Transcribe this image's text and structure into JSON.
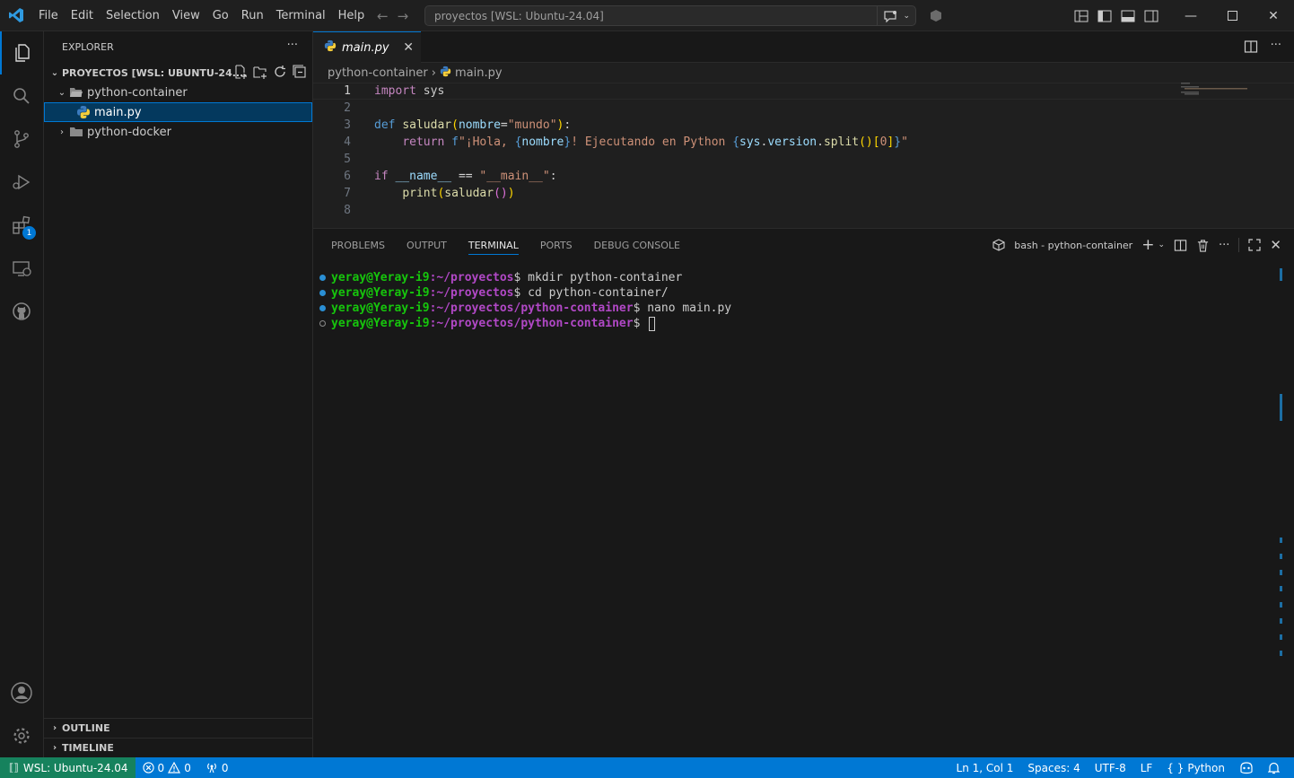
{
  "titlebar": {
    "menu": [
      "File",
      "Edit",
      "Selection",
      "View",
      "Go",
      "Run",
      "Terminal",
      "Help"
    ],
    "search_text": "proyectos [WSL: Ubuntu-24.04]"
  },
  "activitybar": {
    "extensions_badge": "1"
  },
  "sidebar": {
    "title": "EXPLORER",
    "more": "···",
    "folder": "PROYECTOS [WSL: UBUNTU-24....",
    "tree": [
      {
        "label": "python-container"
      },
      {
        "label": "main.py"
      },
      {
        "label": "python-docker"
      }
    ],
    "outline": "OUTLINE",
    "timeline": "TIMELINE"
  },
  "editor": {
    "tab_label": "main.py",
    "breadcrumb": [
      "python-container",
      "main.py"
    ],
    "line_numbers": [
      "1",
      "2",
      "3",
      "4",
      "5",
      "6",
      "7",
      "8"
    ]
  },
  "panel": {
    "tabs": [
      "PROBLEMS",
      "OUTPUT",
      "TERMINAL",
      "PORTS",
      "DEBUG CONSOLE"
    ],
    "terminal_name": "bash - python-container",
    "lines": [
      {
        "user": "yeray@Yeray-i9",
        "path": ":~/proyectos",
        "cmd": "$ mkdir python-container"
      },
      {
        "user": "yeray@Yeray-i9",
        "path": ":~/proyectos",
        "cmd": "$ cd python-container/"
      },
      {
        "user": "yeray@Yeray-i9",
        "path": ":~/proyectos/python-container",
        "cmd": "$ nano main.py"
      },
      {
        "user": "yeray@Yeray-i9",
        "path": ":~/proyectos/python-container",
        "cmd": "$ "
      }
    ]
  },
  "statusbar": {
    "remote": "WSL: Ubuntu-24.04",
    "errors": "0",
    "warnings": "0",
    "ports": "0",
    "position": "Ln 1, Col 1",
    "spaces": "Spaces: 4",
    "encoding": "UTF-8",
    "eol": "LF",
    "language": "Python"
  },
  "colors": {
    "accent": "#0078d4",
    "remote_bg": "#16825d",
    "terminal_user": "#16c60c",
    "terminal_path": "#b148c6"
  }
}
